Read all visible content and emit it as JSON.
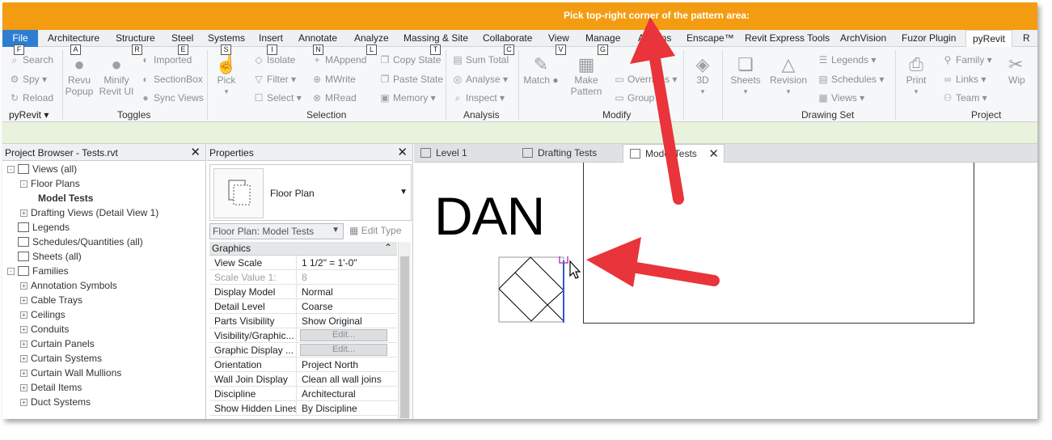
{
  "titlebar": {
    "message": "Pick top-right corner of the pattern area:"
  },
  "tabs": [
    {
      "label": "File"
    },
    {
      "label": "Architecture"
    },
    {
      "label": "Structure"
    },
    {
      "label": "Steel"
    },
    {
      "label": "Systems"
    },
    {
      "label": "Insert"
    },
    {
      "label": "Annotate"
    },
    {
      "label": "Analyze"
    },
    {
      "label": "Massing & Site"
    },
    {
      "label": "Collaborate"
    },
    {
      "label": "View"
    },
    {
      "label": "Manage"
    },
    {
      "label": "Add-Ins"
    },
    {
      "label": "Enscape™"
    },
    {
      "label": "Revit Express Tools"
    },
    {
      "label": "ArchVision"
    },
    {
      "label": "Fuzor Plugin"
    },
    {
      "label": "pyRevit"
    },
    {
      "label": "R"
    }
  ],
  "keytips": [
    "F",
    "A",
    "R",
    "E",
    "S",
    "I",
    "N",
    "L",
    "T",
    "C",
    "V",
    "G"
  ],
  "ribbon": {
    "pyrevit_col": [
      "Search",
      "Spy",
      "Reload"
    ],
    "pyrevit_label": "pyRevit",
    "revu_popup": "Revu\nPopup",
    "minify": "Minify\nRevit UI",
    "toggles_col": [
      "Imported",
      "SectionBox",
      "Sync Views"
    ],
    "toggles_label": "Toggles",
    "pick": "Pick",
    "sel_col1": [
      "Isolate",
      "Filter",
      "Select"
    ],
    "sel_col2": [
      "MAppend",
      "MWrite",
      "MRead"
    ],
    "sel_col3": [
      "Copy State",
      "Paste State",
      "Memory"
    ],
    "selection_label": "Selection",
    "analysis_col": [
      "Sum Total",
      "Analyse",
      "Inspect"
    ],
    "analysis_label": "Analysis",
    "match": "Match",
    "make_pattern": "Make\nPattern",
    "modify_col": [
      "Overrides",
      "Group"
    ],
    "modify_label": "Modify",
    "three_d": "3D",
    "sheets": "Sheets",
    "revision": "Revision",
    "drawing_col": [
      "Legends",
      "Schedules",
      "Views"
    ],
    "drawing_label": "Drawing Set",
    "print": "Print",
    "project_col": [
      "Family",
      "Links",
      "Team"
    ],
    "wipe": "Wip",
    "project_label": "Project"
  },
  "browser": {
    "title": "Project Browser - Tests.rvt",
    "items": [
      {
        "label": "Views (all)",
        "level": 0,
        "exp": "-"
      },
      {
        "label": "Floor Plans",
        "level": 1,
        "exp": "-"
      },
      {
        "label": "Model Tests",
        "level": 2,
        "exp": ""
      },
      {
        "label": "Drafting Views (Detail View 1)",
        "level": 1,
        "exp": "+"
      },
      {
        "label": "Legends",
        "level": 0,
        "exp": ""
      },
      {
        "label": "Schedules/Quantities (all)",
        "level": 0,
        "exp": ""
      },
      {
        "label": "Sheets (all)",
        "level": 0,
        "exp": ""
      },
      {
        "label": "Families",
        "level": 0,
        "exp": "-"
      },
      {
        "label": "Annotation Symbols",
        "level": 1,
        "exp": "+"
      },
      {
        "label": "Cable Trays",
        "level": 1,
        "exp": "+"
      },
      {
        "label": "Ceilings",
        "level": 1,
        "exp": "+"
      },
      {
        "label": "Conduits",
        "level": 1,
        "exp": "+"
      },
      {
        "label": "Curtain Panels",
        "level": 1,
        "exp": "+"
      },
      {
        "label": "Curtain Systems",
        "level": 1,
        "exp": "+"
      },
      {
        "label": "Curtain Wall Mullions",
        "level": 1,
        "exp": "+"
      },
      {
        "label": "Detail Items",
        "level": 1,
        "exp": "+"
      },
      {
        "label": "Duct Systems",
        "level": 1,
        "exp": "+"
      }
    ]
  },
  "properties": {
    "title": "Properties",
    "type_name": "Floor Plan",
    "instance": "Floor Plan: Model Tests",
    "edit_type": "Edit Type",
    "group": "Graphics",
    "rows": [
      {
        "k": "View Scale",
        "v": "1 1/2\" = 1'-0\""
      },
      {
        "k": "Scale Value    1:",
        "v": "8"
      },
      {
        "k": "Display Model",
        "v": "Normal"
      },
      {
        "k": "Detail Level",
        "v": "Coarse"
      },
      {
        "k": "Parts Visibility",
        "v": "Show Original"
      },
      {
        "k": "Visibility/Graphic...",
        "v": "Edit..."
      },
      {
        "k": "Graphic Display ...",
        "v": "Edit..."
      },
      {
        "k": "Orientation",
        "v": "Project North"
      },
      {
        "k": "Wall Join Display",
        "v": "Clean all wall joins"
      },
      {
        "k": "Discipline",
        "v": "Architectural"
      },
      {
        "k": "Show Hidden Lines",
        "v": "By Discipline"
      }
    ]
  },
  "view_tabs": [
    "Level 1",
    "Drafting Tests",
    "Model Tests"
  ],
  "canvas": {
    "text": "DAN"
  },
  "colors": {
    "titlebar": "#f39c12",
    "file_tab": "#2d7ed1",
    "arrow": "#e8343a",
    "options_bar": "#e9f2dc"
  }
}
